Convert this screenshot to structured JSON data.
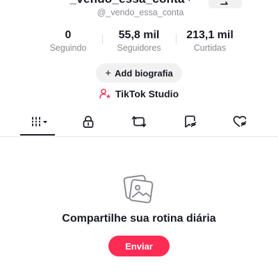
{
  "profile": {
    "display_name": "_vendo_essa_conta",
    "username": "@_vendo_essa_conta",
    "dropdown_icon": "chevron-down-icon"
  },
  "stats": {
    "following": {
      "value": "0",
      "label": "Seguindo"
    },
    "followers": {
      "value": "55,8 mil",
      "label": "Seguidores"
    },
    "likes": {
      "value": "213,1 mil",
      "label": "Curtidas"
    }
  },
  "actions": {
    "add_bio_label": "Add biografia",
    "studio_label": "TikTok Studio"
  },
  "tabs": [
    {
      "icon": "videos-grid-icon",
      "active": true
    },
    {
      "icon": "lock-icon",
      "active": false
    },
    {
      "icon": "repost-icon",
      "active": false
    },
    {
      "icon": "saved-icon",
      "active": false
    },
    {
      "icon": "liked-icon",
      "active": false
    }
  ],
  "empty_state": {
    "icon": "photos-icon",
    "title": "Compartilhe sua rotina diária",
    "button_label": "Enviar"
  },
  "colors": {
    "accent": "#fe2c55",
    "studio_icon": "#fe2c55",
    "text": "#161823",
    "muted": "#8a8b91"
  }
}
